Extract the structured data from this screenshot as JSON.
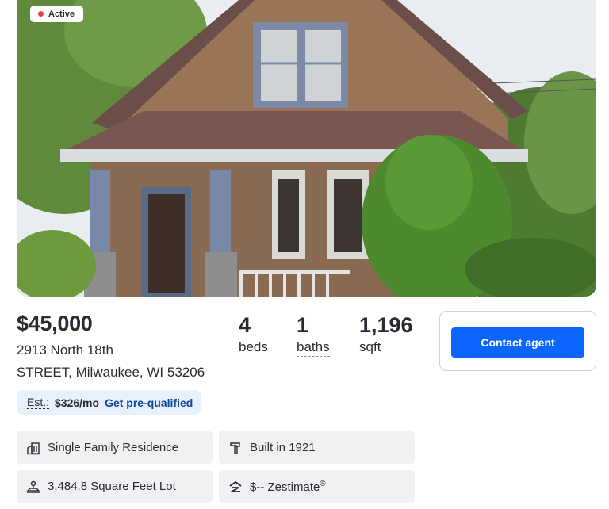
{
  "listing": {
    "status": "Active",
    "price": "$45,000",
    "address_line1": "2913 North 18th",
    "address_line2": "STREET, Milwaukee, WI 53206"
  },
  "stats": {
    "beds_value": "4",
    "beds_label": "beds",
    "baths_value": "1",
    "baths_label": "baths",
    "sqft_value": "1,196",
    "sqft_label": "sqft"
  },
  "contact": {
    "button_label": "Contact agent"
  },
  "estimate": {
    "label": "Est.:",
    "value": "$326/mo",
    "link": "Get pre-qualified"
  },
  "facts": {
    "type": "Single Family Residence",
    "built": "Built in 1921",
    "lot": "3,484.8 Square Feet Lot",
    "zestimate": "$-- Zestimate",
    "zestimate_mark": "®"
  },
  "icons": {
    "type": "building-icon",
    "built": "hammer-icon",
    "lot": "lot-size-icon",
    "zestimate": "zestimate-logo-icon"
  },
  "colors": {
    "accent": "#0b66ff",
    "status_dot": "#e2463a",
    "link": "#0d4599",
    "estimate_bg": "#e7f1fb",
    "fact_bg": "#f1f1f4"
  }
}
